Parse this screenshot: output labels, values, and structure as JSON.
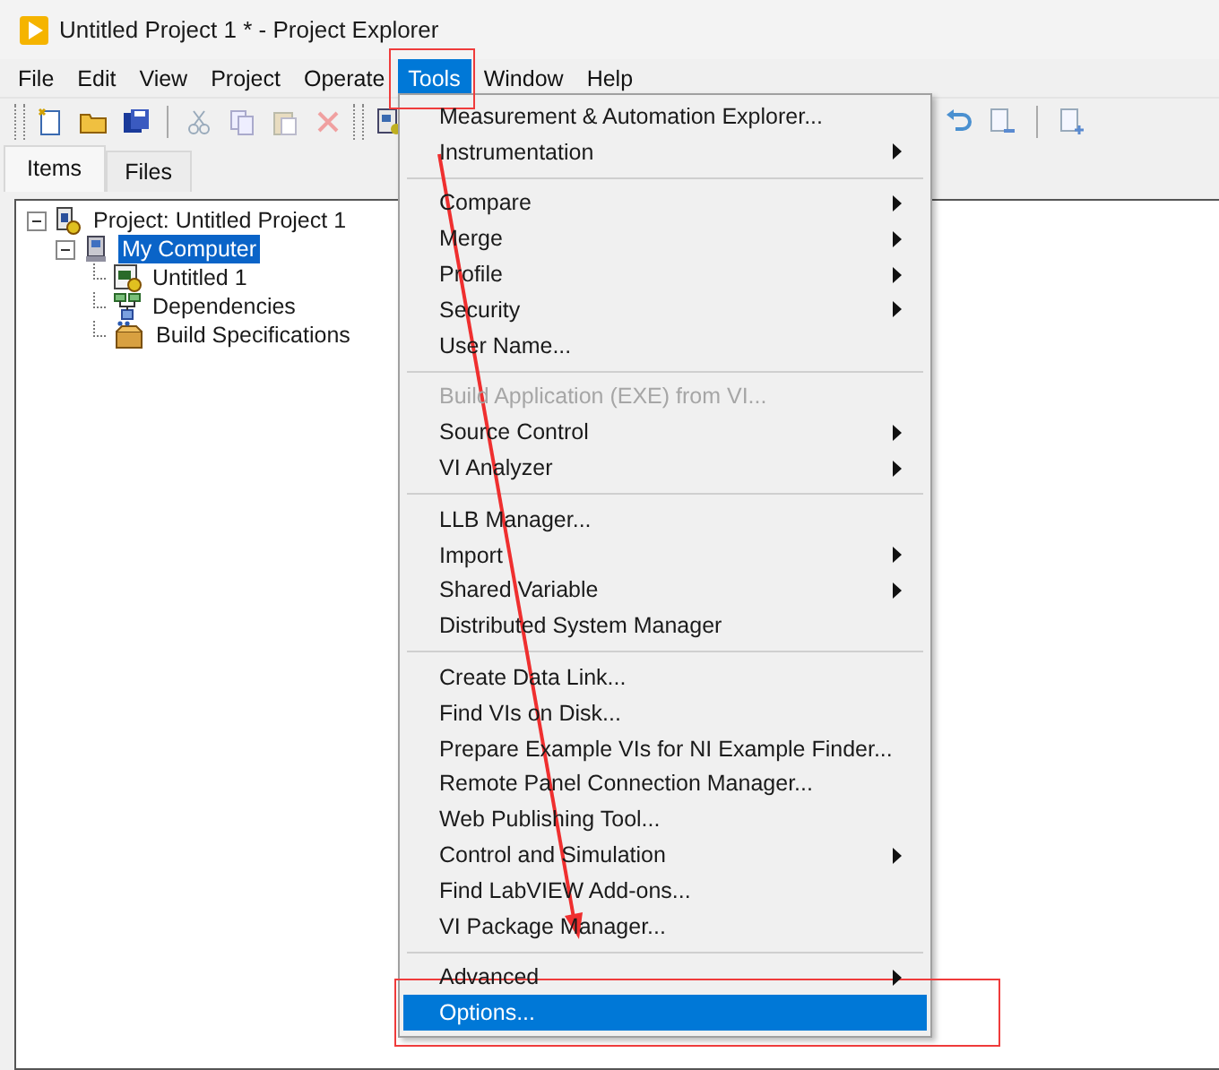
{
  "window": {
    "title": "Untitled Project 1 * - Project Explorer"
  },
  "menu_bar": [
    {
      "label": "File",
      "selected": false
    },
    {
      "label": "Edit",
      "selected": false
    },
    {
      "label": "View",
      "selected": false
    },
    {
      "label": "Project",
      "selected": false
    },
    {
      "label": "Operate",
      "selected": false
    },
    {
      "label": "Tools",
      "selected": true
    },
    {
      "label": "Window",
      "selected": false
    },
    {
      "label": "Help",
      "selected": false
    }
  ],
  "tabs": [
    {
      "label": "Items",
      "selected": true
    },
    {
      "label": "Files",
      "selected": false
    }
  ],
  "tree": [
    {
      "label": "Project: Untitled Project 1",
      "expanded": true,
      "selected": false,
      "children": [
        {
          "label": "My Computer",
          "expanded": true,
          "selected": true,
          "children": [
            {
              "label": "Untitled 1",
              "selected": false
            },
            {
              "label": "Dependencies",
              "selected": false
            },
            {
              "label": "Build Specifications",
              "selected": false
            }
          ]
        }
      ]
    }
  ],
  "tools_menu": [
    {
      "kind": "item",
      "label": "Measurement & Automation Explorer...",
      "submenu": false,
      "disabled": false,
      "selected": false
    },
    {
      "kind": "item",
      "label": "Instrumentation",
      "submenu": true,
      "disabled": false,
      "selected": false
    },
    {
      "kind": "separator"
    },
    {
      "kind": "item",
      "label": "Compare",
      "submenu": true,
      "disabled": false,
      "selected": false
    },
    {
      "kind": "item",
      "label": "Merge",
      "submenu": true,
      "disabled": false,
      "selected": false
    },
    {
      "kind": "item",
      "label": "Profile",
      "submenu": true,
      "disabled": false,
      "selected": false
    },
    {
      "kind": "item",
      "label": "Security",
      "submenu": true,
      "disabled": false,
      "selected": false
    },
    {
      "kind": "item",
      "label": "User Name...",
      "submenu": false,
      "disabled": false,
      "selected": false
    },
    {
      "kind": "separator"
    },
    {
      "kind": "item",
      "label": "Build Application (EXE) from VI...",
      "submenu": false,
      "disabled": true,
      "selected": false
    },
    {
      "kind": "item",
      "label": "Source Control",
      "submenu": true,
      "disabled": false,
      "selected": false
    },
    {
      "kind": "item",
      "label": "VI Analyzer",
      "submenu": true,
      "disabled": false,
      "selected": false
    },
    {
      "kind": "separator"
    },
    {
      "kind": "item",
      "label": "LLB Manager...",
      "submenu": false,
      "disabled": false,
      "selected": false
    },
    {
      "kind": "item",
      "label": "Import",
      "submenu": true,
      "disabled": false,
      "selected": false
    },
    {
      "kind": "item",
      "label": "Shared Variable",
      "submenu": true,
      "disabled": false,
      "selected": false
    },
    {
      "kind": "item",
      "label": "Distributed System Manager",
      "submenu": false,
      "disabled": false,
      "selected": false
    },
    {
      "kind": "separator"
    },
    {
      "kind": "item",
      "label": "Create Data Link...",
      "submenu": false,
      "disabled": false,
      "selected": false
    },
    {
      "kind": "item",
      "label": "Find VIs on Disk...",
      "submenu": false,
      "disabled": false,
      "selected": false
    },
    {
      "kind": "item",
      "label": "Prepare Example VIs for NI Example Finder...",
      "submenu": false,
      "disabled": false,
      "selected": false
    },
    {
      "kind": "item",
      "label": "Remote Panel Connection Manager...",
      "submenu": false,
      "disabled": false,
      "selected": false
    },
    {
      "kind": "item",
      "label": "Web Publishing Tool...",
      "submenu": false,
      "disabled": false,
      "selected": false
    },
    {
      "kind": "item",
      "label": "Control and Simulation",
      "submenu": true,
      "disabled": false,
      "selected": false
    },
    {
      "kind": "item",
      "label": "Find LabVIEW Add-ons...",
      "submenu": false,
      "disabled": false,
      "selected": false
    },
    {
      "kind": "item",
      "label": "VI Package Manager...",
      "submenu": false,
      "disabled": false,
      "selected": false
    },
    {
      "kind": "separator"
    },
    {
      "kind": "item",
      "label": "Advanced",
      "submenu": true,
      "disabled": false,
      "selected": false
    },
    {
      "kind": "item",
      "label": "Options...",
      "submenu": false,
      "disabled": false,
      "selected": true
    }
  ]
}
